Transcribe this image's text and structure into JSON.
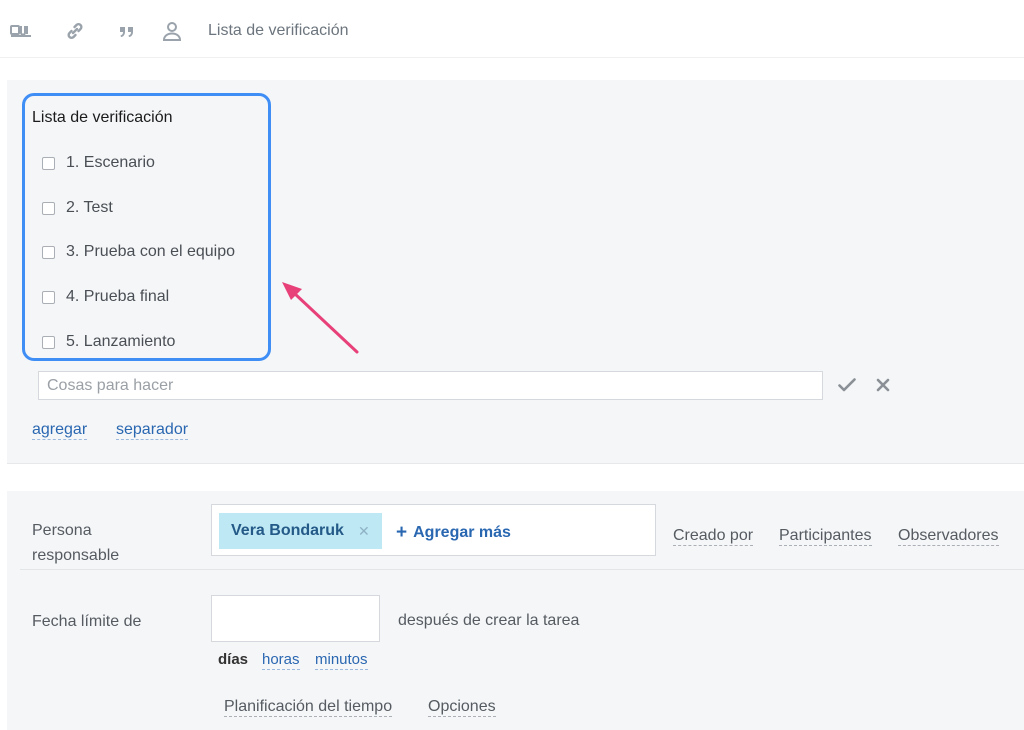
{
  "toolbar": {
    "icons": [
      "video-icon",
      "link-icon",
      "quote-icon",
      "user-icon"
    ],
    "label": "Lista de verificación"
  },
  "checklist": {
    "title": "Lista de verificación",
    "items": [
      {
        "label": "1. Escenario",
        "checked": false
      },
      {
        "label": "2. Test",
        "checked": false
      },
      {
        "label": "3. Prueba con el equipo",
        "checked": false
      },
      {
        "label": "4. Prueba final",
        "checked": false
      },
      {
        "label": "5. Lanzamiento",
        "checked": false
      }
    ],
    "input": {
      "value": "",
      "placeholder": "Cosas para hacer"
    },
    "actions": {
      "add": "agregar",
      "separator": "separador"
    }
  },
  "responsible": {
    "label": "Persona responsable",
    "user": "Vera Bondaruk",
    "add_more": "Agregar más",
    "roles": {
      "created_by": "Creado por",
      "participants": "Participantes",
      "observers": "Observadores"
    }
  },
  "deadline": {
    "label": "Fecha límite de",
    "value": "",
    "suffix": "después de crear la tarea",
    "units": {
      "days": "días",
      "hours": "horas",
      "minutes": "minutos"
    },
    "active_unit": "días"
  },
  "footer_links": {
    "time_planning": "Planificación del tiempo",
    "options": "Opciones"
  },
  "colors": {
    "highlight": "#3f8ef5",
    "arrow": "#e8417a",
    "link": "#2a67b1",
    "chip": "#bfe8f5"
  }
}
